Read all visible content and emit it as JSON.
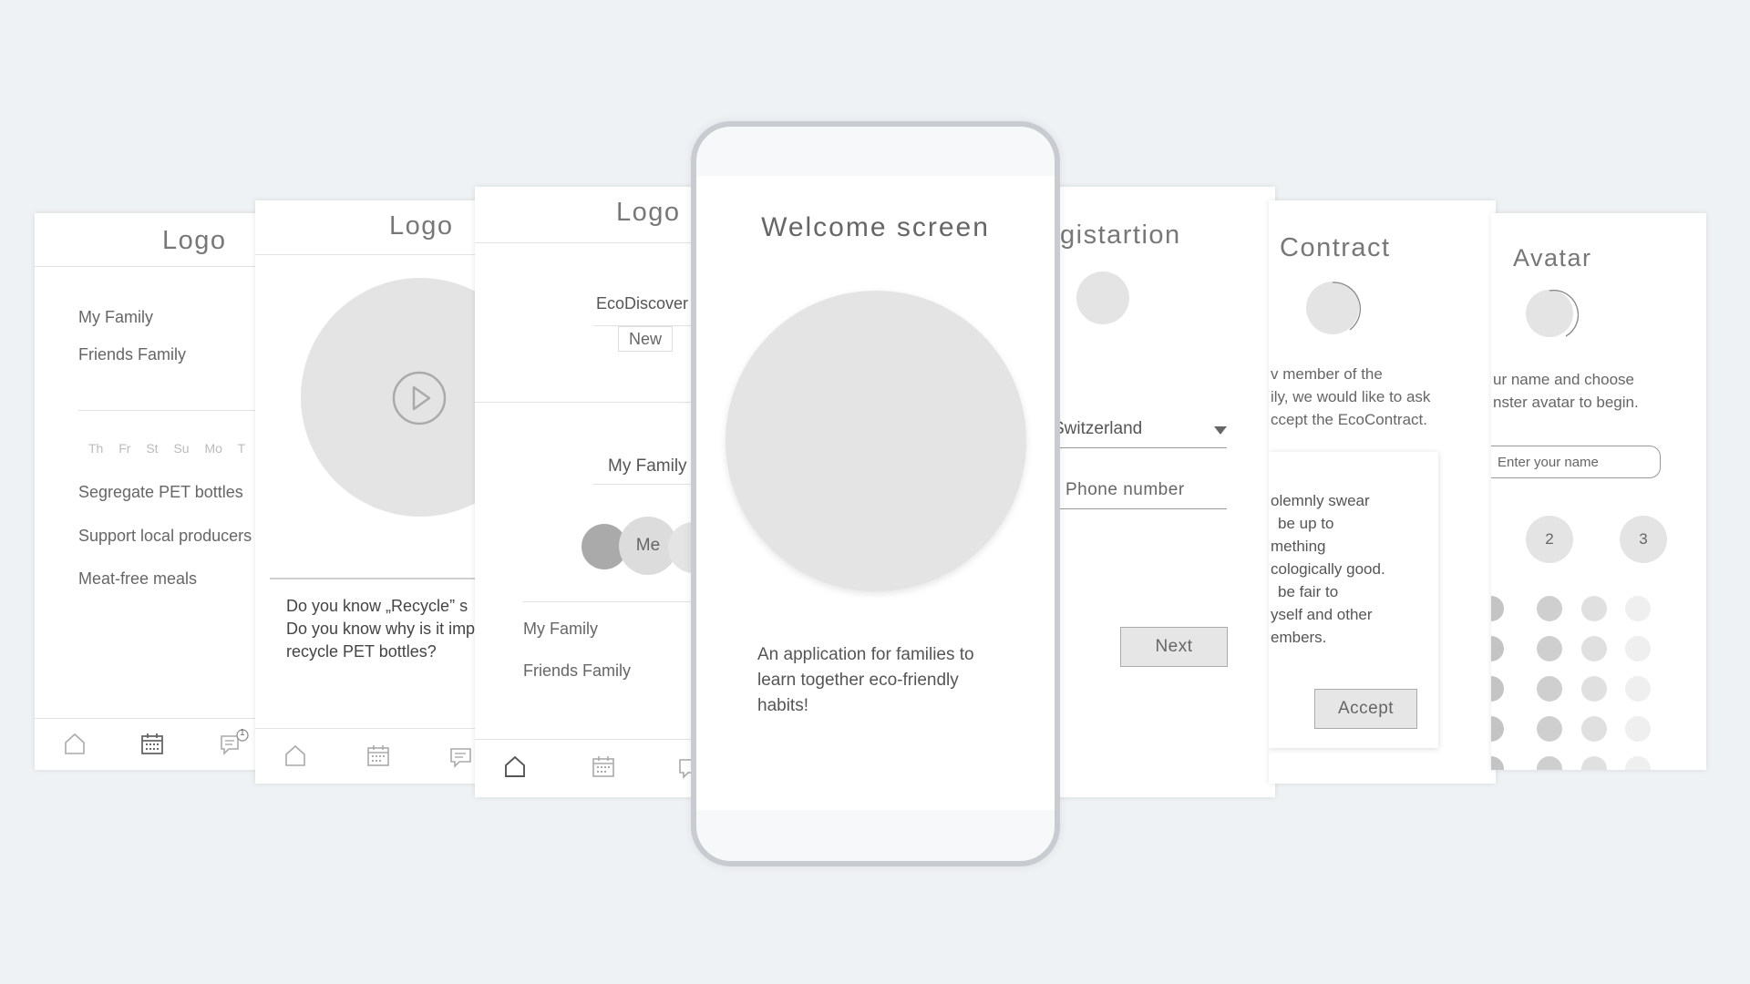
{
  "screen1": {
    "logo": "Logo",
    "families": [
      "My Family",
      "Friends Family"
    ],
    "days": [
      "Th",
      "Fr",
      "St",
      "Su",
      "Mo",
      "T"
    ],
    "tasks": [
      "Segregate PET bottles",
      "Support local producers",
      "Meat-free meals"
    ],
    "chat_badge": "1"
  },
  "screen2": {
    "logo": "Logo",
    "quiz_lines": [
      "Do you know „Recycle” s",
      "Do you know why is it imp",
      "recycle PET bottles?"
    ]
  },
  "screen3": {
    "logo": "Logo",
    "app_name": "EcoDiscover",
    "new_label": "New",
    "family_header": "My Family",
    "member_me": "Me",
    "families": [
      "My Family",
      "Friends Family"
    ]
  },
  "welcome": {
    "title": "Welcome screen",
    "description_lines": [
      "An application for families to",
      "learn together eco-friendly",
      "habits!"
    ]
  },
  "registration": {
    "title": "gistartion",
    "country_value": "Switzerland",
    "phone_placeholder": "Phone number",
    "next_label": "Next"
  },
  "contract": {
    "title": "Contract",
    "intro_lines": [
      "v member of the",
      "ily, we would like to ask",
      "ccept the EcoContract."
    ],
    "oath_lines": [
      "olemnly swear",
      "be up to",
      "mething",
      "cologically good.",
      "be fair to",
      "yself and other",
      "embers."
    ],
    "accept_label": "Accept"
  },
  "avatar": {
    "title": "Avatar",
    "intro_lines": [
      "ur name and choose",
      "nster avatar to begin."
    ],
    "name_placeholder": "Enter your name",
    "steps": [
      "2",
      "3"
    ]
  }
}
